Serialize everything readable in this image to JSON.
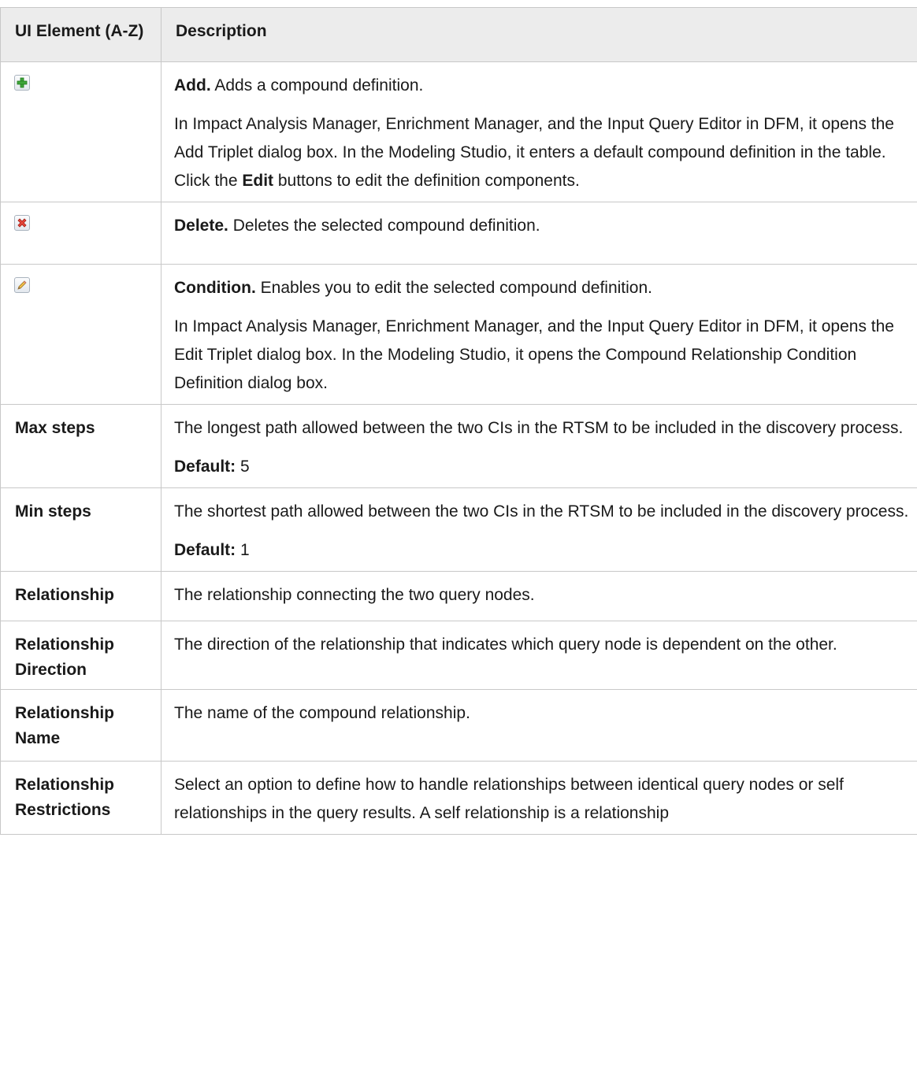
{
  "header": {
    "col1": "UI Element (A-Z)",
    "col2": "Description"
  },
  "rows": [
    {
      "icon": "add-icon",
      "desc": [
        {
          "bold": "Add.",
          "text": " Adds a compound definition."
        },
        {
          "pre": "In Impact Analysis Manager, Enrichment Manager, and the Input Query Editor in DFM, it opens the Add Triplet dialog box. In the Modeling Studio, it enters a default compound definition in the table. Click the ",
          "bold": "Edit",
          "post": " buttons to edit the definition components."
        }
      ]
    },
    {
      "icon": "delete-icon",
      "desc": [
        {
          "bold": "Delete.",
          "text": " Deletes the selected compound definition."
        }
      ]
    },
    {
      "icon": "edit-pencil-icon",
      "desc": [
        {
          "bold": "Condition.",
          "text": " Enables you to edit the selected compound definition."
        },
        {
          "text": "In Impact Analysis Manager, Enrichment Manager, and the Input Query Editor in DFM, it opens the Edit Triplet dialog box. In the Modeling Studio, it opens the Compound Relationship Condition Definition dialog box."
        }
      ]
    },
    {
      "label": "Max steps",
      "desc": [
        {
          "text": "The longest path allowed between the two CIs in the RTSM to be included in the discovery process."
        },
        {
          "bold": "Default:",
          "text": " 5"
        }
      ]
    },
    {
      "label": "Min steps",
      "desc": [
        {
          "text": "The shortest path allowed between the two CIs in the RTSM to be included in the discovery process."
        },
        {
          "bold": "Default:",
          "text": " 1"
        }
      ]
    },
    {
      "label": "Relationship",
      "desc": [
        {
          "text": "The relationship connecting the two query nodes."
        }
      ]
    },
    {
      "label": "Relationship Direction",
      "desc": [
        {
          "text": "The direction of the relationship that indicates which query node is dependent on the other."
        }
      ]
    },
    {
      "label": "Relationship Name",
      "desc": [
        {
          "text": "The name of the compound relationship."
        }
      ]
    },
    {
      "label": "Relationship Restrictions",
      "desc": [
        {
          "text": "Select an option to define how to handle relationships between identical query nodes or self relationships in the query results. A self relationship is a relationship"
        }
      ]
    }
  ]
}
